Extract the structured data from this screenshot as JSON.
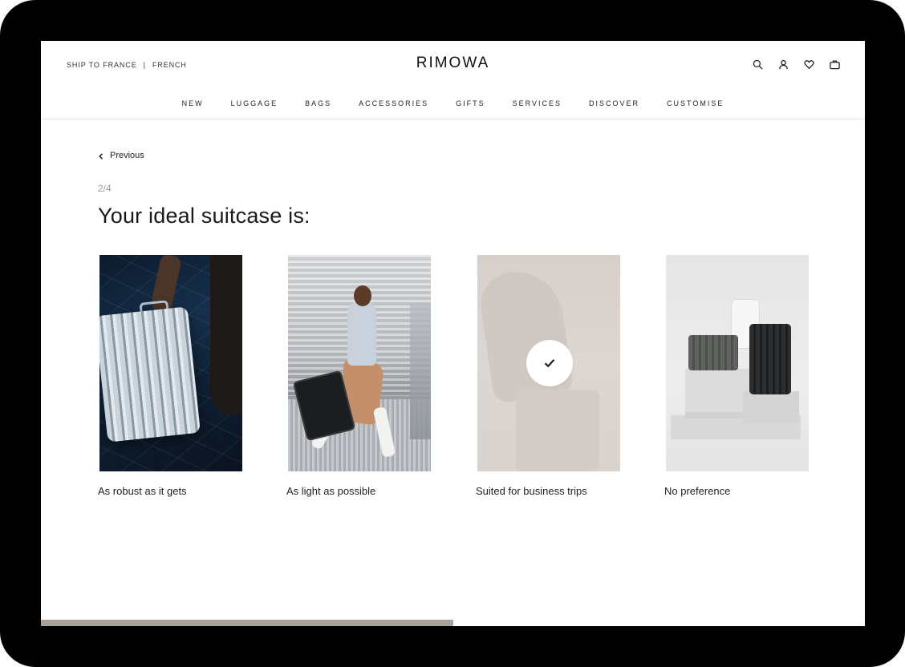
{
  "header": {
    "locale": {
      "ship_to": "SHIP TO FRANCE",
      "separator": "|",
      "language": "FRENCH"
    },
    "brand": "RIMOWA",
    "icons": [
      "search-icon",
      "account-icon",
      "wishlist-icon",
      "cart-icon"
    ]
  },
  "nav": {
    "items": [
      {
        "label": "NEW"
      },
      {
        "label": "LUGGAGE"
      },
      {
        "label": "BAGS"
      },
      {
        "label": "ACCESSORIES"
      },
      {
        "label": "GIFTS"
      },
      {
        "label": "SERVICES"
      },
      {
        "label": "DISCOVER"
      },
      {
        "label": "CUSTOMISE"
      }
    ]
  },
  "quiz": {
    "previous_label": "Previous",
    "step": "2/4",
    "question": "Your ideal suitcase is:",
    "progress_fraction": 0.5,
    "options": [
      {
        "label": "As robust as it gets",
        "selected": false
      },
      {
        "label": "As light as possible",
        "selected": false
      },
      {
        "label": "Suited for business trips",
        "selected": true
      },
      {
        "label": "No preference",
        "selected": false
      }
    ]
  },
  "colors": {
    "progress": "#a8a29a",
    "text": "#1a1a1a",
    "muted": "#9a9a9a"
  }
}
